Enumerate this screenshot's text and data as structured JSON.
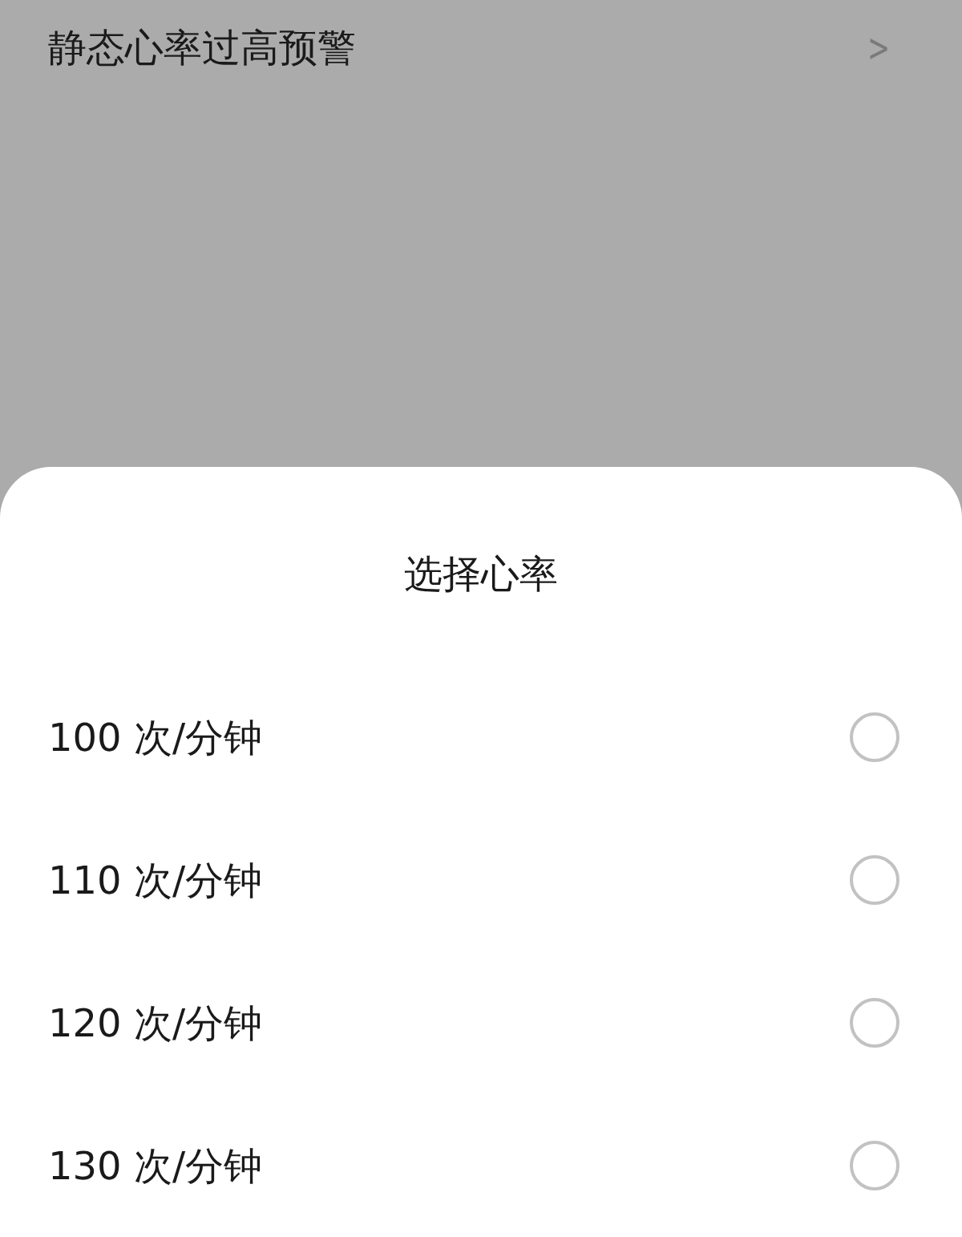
{
  "background_item": {
    "label": "静态心率过高预警",
    "chevron": ">"
  },
  "sheet": {
    "title": "选择心率",
    "options": [
      {
        "label": "100 次/分钟",
        "selected": false
      },
      {
        "label": "110 次/分钟",
        "selected": false
      },
      {
        "label": "120 次/分钟",
        "selected": false
      },
      {
        "label": "130 次/分钟",
        "selected": false
      }
    ]
  }
}
